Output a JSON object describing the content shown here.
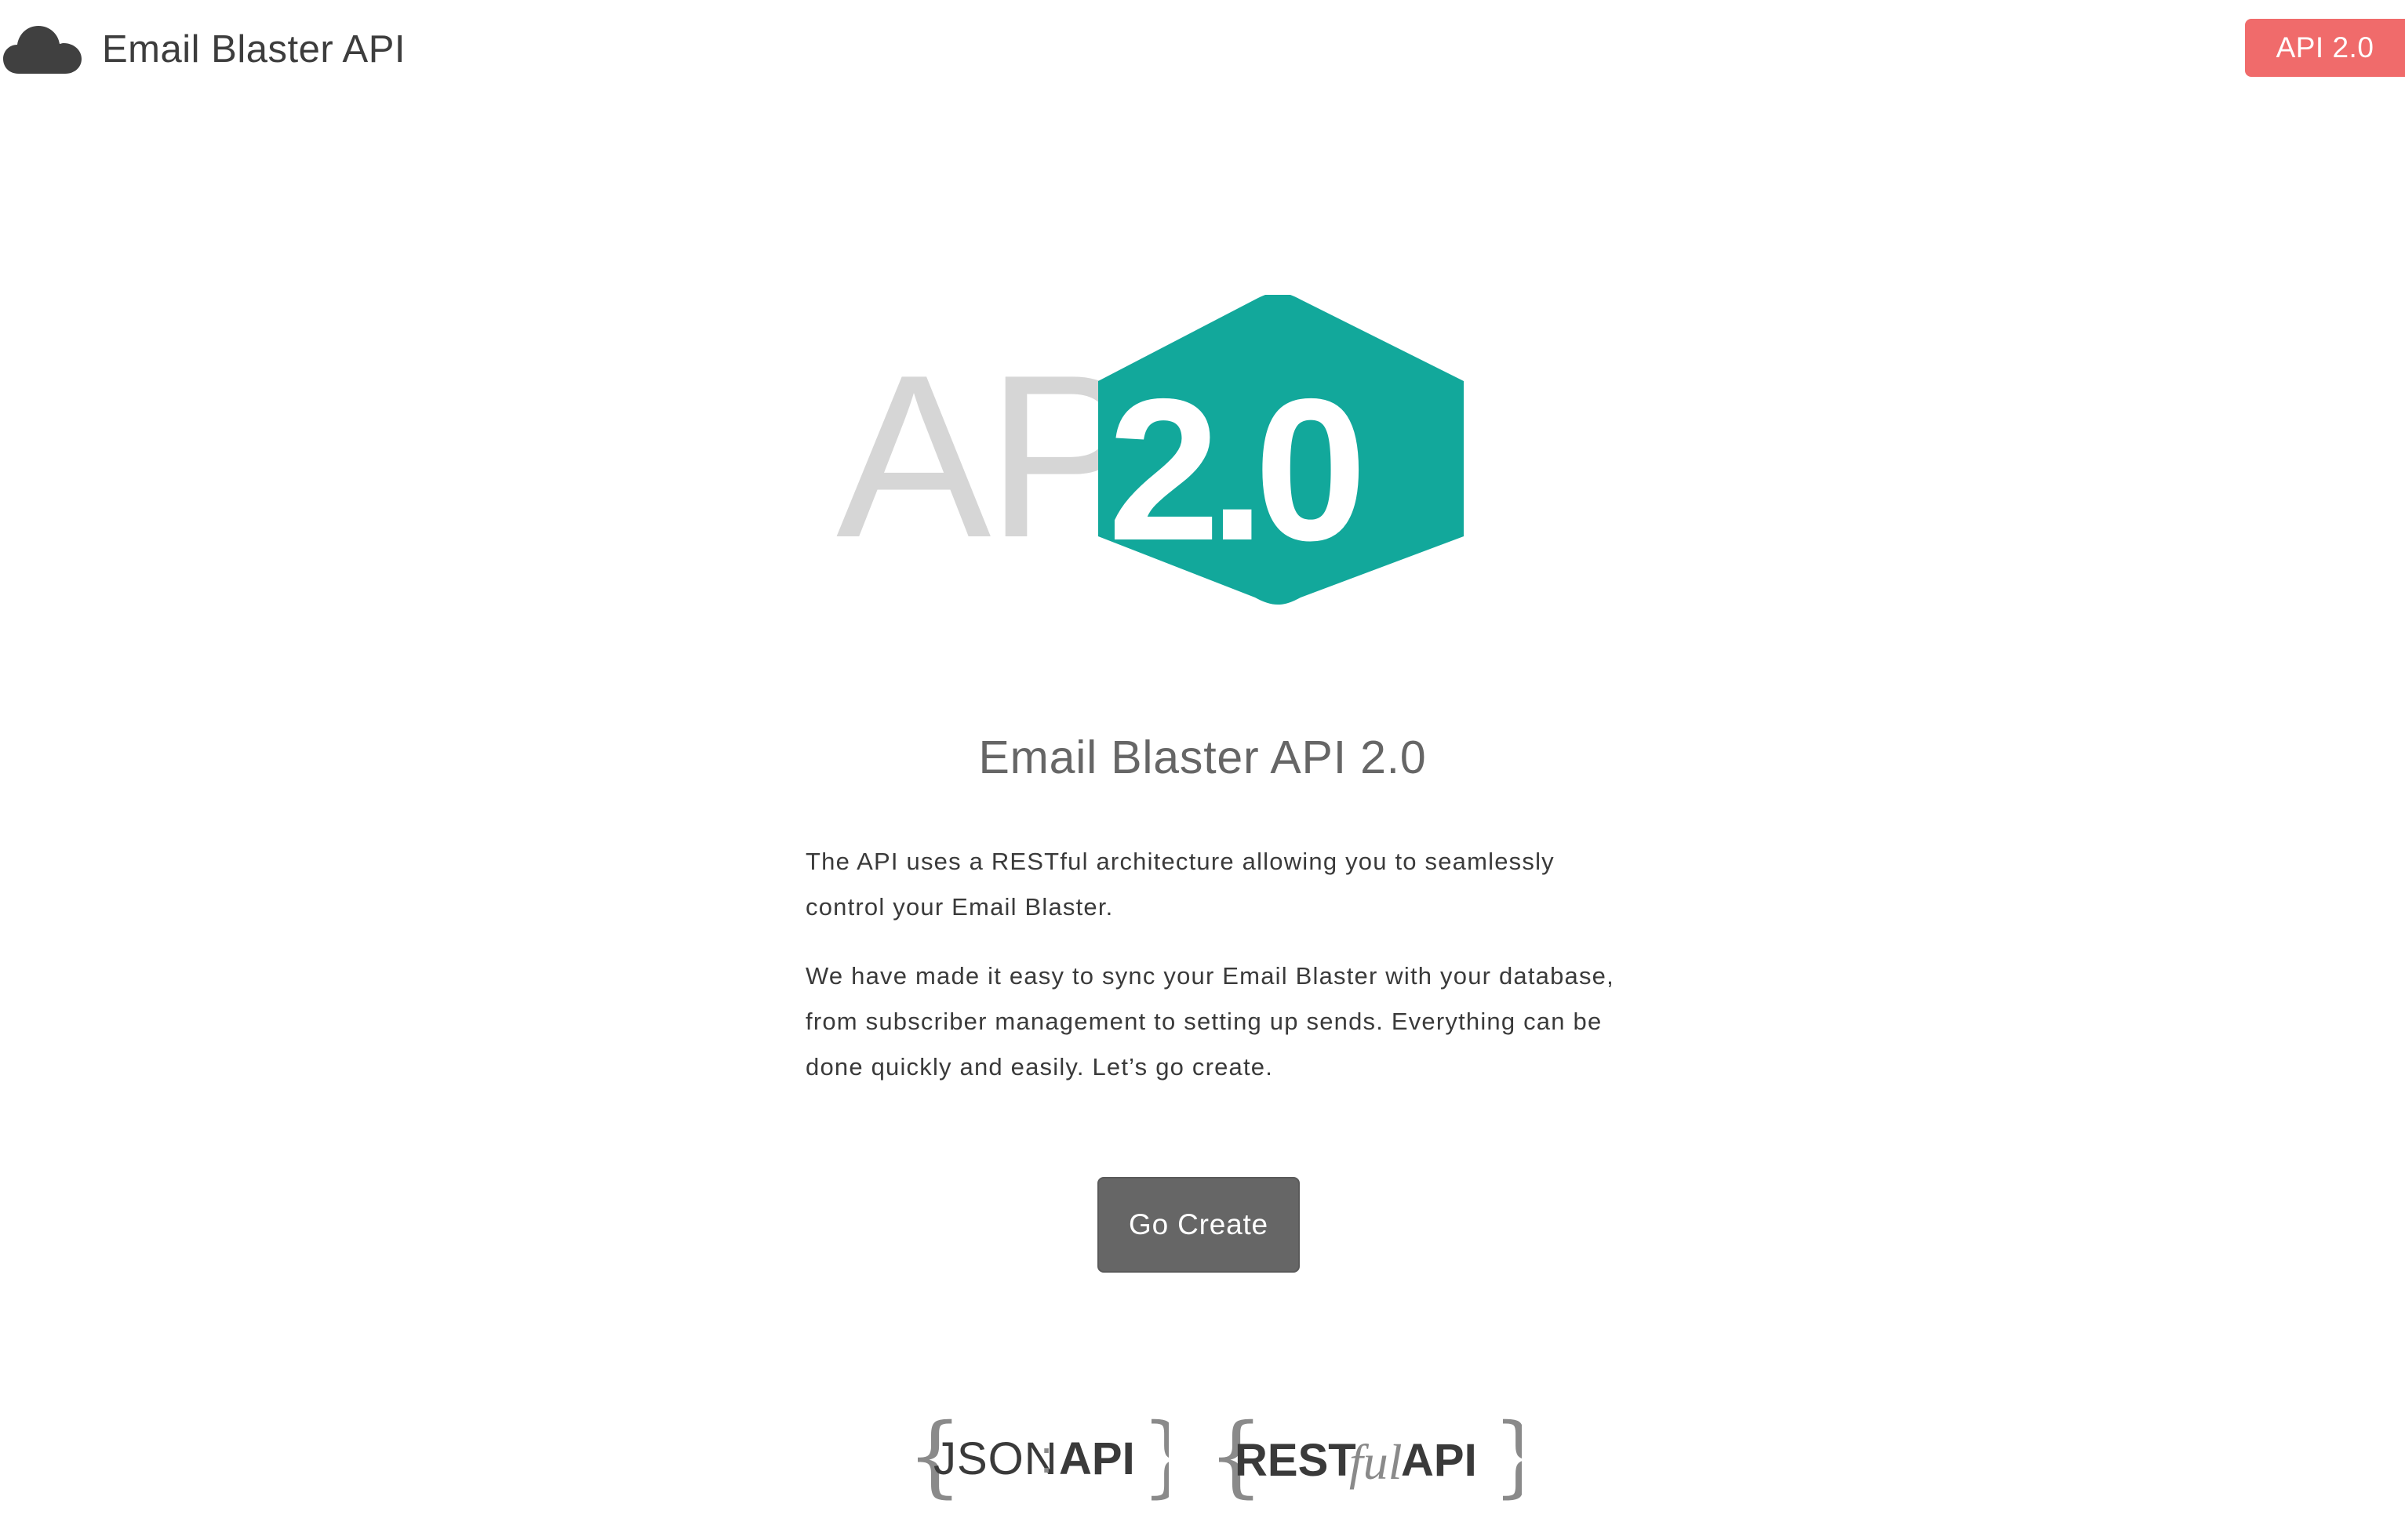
{
  "header": {
    "brand_icon": "cloud-icon",
    "brand_title": "Email Blaster API",
    "version_badge": "API 2.0"
  },
  "hero": {
    "logo_text_api": "API",
    "logo_text_version": "2.0"
  },
  "main": {
    "heading": "Email Blaster API 2.0",
    "paragraphs": [
      "The API uses a RESTful architecture allowing you to seamlessly control your Email Blaster.",
      "We have made it easy to sync your Email Blaster with your database, from subscriber management to setting up sends. Everything can be done quickly and easily. Let’s go create."
    ],
    "cta_label": "Go Create"
  },
  "badges": {
    "json_api": {
      "left": "JSON",
      "sep": ":",
      "right": "API"
    },
    "restful_api": {
      "left": "REST",
      "middle": "ful",
      "right": "API"
    }
  },
  "colors": {
    "badge_red": "#f06b6b",
    "logo_teal": "#12a89b",
    "logo_grey": "#d6d6d6",
    "button_grey": "#666666"
  }
}
